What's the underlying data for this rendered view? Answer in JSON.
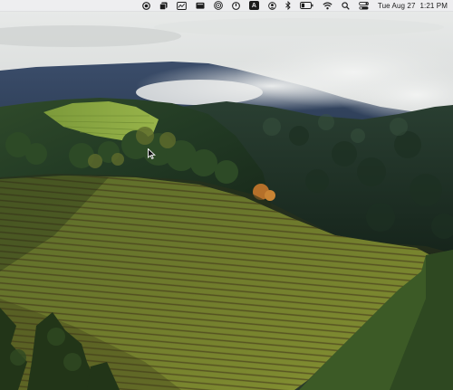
{
  "desktop": {
    "wallpaper": "vineyard-hills-landscape"
  },
  "menubar": {
    "status_items": [
      {
        "icon": "record-icon"
      },
      {
        "icon": "window-stack-icon"
      },
      {
        "icon": "screen-graph-icon"
      },
      {
        "icon": "media-display-icon"
      },
      {
        "icon": "airdrop-icon"
      },
      {
        "icon": "power-icon"
      },
      {
        "icon": "input-source-icon",
        "label": "A"
      },
      {
        "icon": "user-account-icon"
      },
      {
        "icon": "bluetooth-icon"
      },
      {
        "icon": "battery-icon",
        "level": 0.35
      },
      {
        "icon": "wifi-icon"
      },
      {
        "icon": "spotlight-search-icon"
      },
      {
        "icon": "control-center-icon"
      }
    ],
    "clock": {
      "date": "Tue Aug 27",
      "time": "1:21 PM"
    }
  },
  "colors": {
    "menubar_bg": "#eeeef0",
    "menubar_text": "#1a1a1a"
  }
}
